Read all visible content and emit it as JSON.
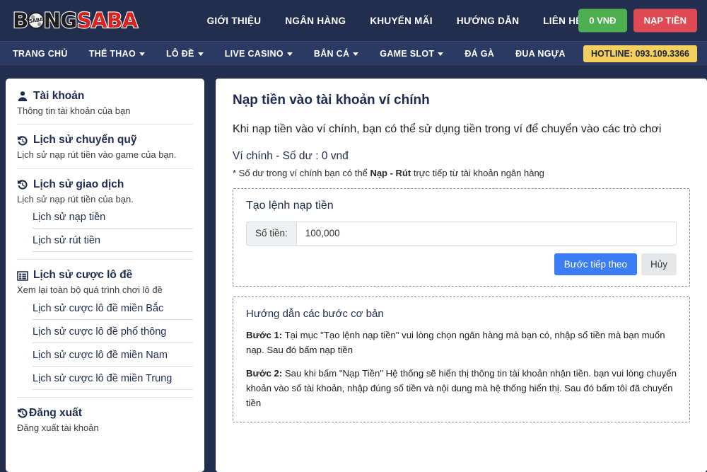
{
  "brand": {
    "logo_part1": "B",
    "logo_ball_text": "SABA",
    "logo_part2": "NG",
    "logo_part3": "SABA"
  },
  "topnav": {
    "items": [
      {
        "label": "GIỚI THIỆU"
      },
      {
        "label": "NGÂN HÀNG"
      },
      {
        "label": "KHUYẾN MÃI"
      },
      {
        "label": "HƯỚNG DẪN"
      },
      {
        "label": "LIÊN HỆ"
      }
    ],
    "balance_button": "0 VNĐ",
    "deposit_button": "NẠP TIỀN"
  },
  "mainnav": {
    "items": [
      {
        "label": "TRANG CHỦ",
        "caret": false
      },
      {
        "label": "THỂ THAO",
        "caret": true
      },
      {
        "label": "LÔ ĐỀ",
        "caret": true
      },
      {
        "label": "LIVE CASINO",
        "caret": true
      },
      {
        "label": "BẮN CÁ",
        "caret": true
      },
      {
        "label": "GAME SLOT",
        "caret": true
      },
      {
        "label": "ĐÁ GÀ",
        "caret": false
      },
      {
        "label": "ĐUA NGỰA",
        "caret": false
      }
    ],
    "hotline": "HOTLINE: 093.109.3366"
  },
  "sidebar": {
    "groups": [
      {
        "icon": "user-icon",
        "title": "Tài khoản",
        "desc": "Thông tin tài khoản của bạn",
        "subs": []
      },
      {
        "icon": "history-icon",
        "title": "Lịch sử chuyển quỹ",
        "desc": "Lịch sử nạp rút tiền vào game của bạn.",
        "subs": []
      },
      {
        "icon": "history-icon",
        "title": "Lịch sử giao dịch",
        "desc": "Lịch sử nạp rút tiền của bạn.",
        "subs": [
          {
            "label": "Lịch sử nạp tiền"
          },
          {
            "label": "Lịch sử rút tiền"
          }
        ]
      },
      {
        "icon": "list-icon",
        "title": "Lịch sử cược lô đề",
        "desc": "Xem lại toàn bộ quá trình chơi lô đề",
        "subs": [
          {
            "label": "Lịch sử cược lô đề miền Bắc"
          },
          {
            "label": "Lịch sử cược lô đề phổ thông"
          },
          {
            "label": "Lịch sử cược lô đề miền Nam"
          },
          {
            "label": "Lịch sử cược lô đề miền Trung"
          }
        ]
      },
      {
        "icon": "logout-icon",
        "title": "Đăng xuất",
        "desc": "Đăng xuất tài khoản",
        "subs": []
      }
    ]
  },
  "content": {
    "title": "Nạp tiền vào tài khoản ví chính",
    "lead": "Khi nạp tiền vào ví chính, bạn có thể sử dụng tiền trong ví để chuyển vào các trò chơi",
    "balance_line": "Ví chính - Số dư : 0 vnđ",
    "note_before": "* Số dư trong ví chính bạn có thể ",
    "note_bold": "Nạp - Rút",
    "note_after": " trực tiếp từ tài khoản ngân hàng",
    "form": {
      "title": "Tạo lệnh nạp tiền",
      "amount_label": "Số tiền:",
      "amount_value": "100,000",
      "amount_placeholder": "Số tiền",
      "submit_label": "Bước tiếp theo",
      "cancel_label": "Hủy"
    },
    "guide": {
      "title": "Hướng dẫn các bước cơ bản",
      "step1_label": "Bước 1:",
      "step1_text": " Tại mục \"Tạo lệnh nạp tiền\" vui lòng chọn ngân hàng mà bạn có, nhập số tiền mà bạn muốn nạp. Sau đó bấm nạp tiền",
      "step2_label": "Bước 2:",
      "step2_text": " Sau khi bấm \"Nạp Tiền\" Hệ thống sẽ hiển thị thông tin tài khoản nhận tiền. bạn vui lòng chuyển khoản vào số tài khoản, nhập đúng số tiền và nội dung mà hệ thống hiển thị. Sau đó bấm tôi đã chuyển tiền"
    }
  },
  "colors": {
    "page_bg": "#222e4d",
    "nav_bg": "#2b3a63",
    "accent_blue": "#3b7df5",
    "balance_green": "#4caf50",
    "deposit_red": "#e04a55",
    "hotline_yellow": "#f5cf5e",
    "heading_navy": "#1d2b50",
    "logo_red": "#d8231f"
  }
}
